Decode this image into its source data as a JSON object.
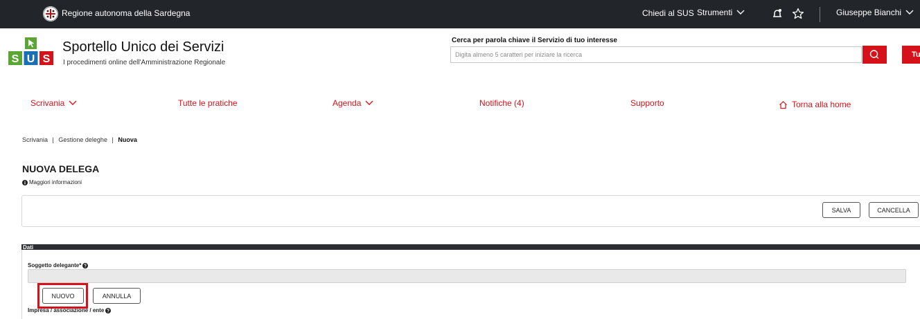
{
  "topbar": {
    "region": "Regione autonoma della Sardegna",
    "ask": "Chiedi al SUS",
    "tools": "Strumenti",
    "user": "Giuseppe Bianchi"
  },
  "header": {
    "logo_letters": [
      "S",
      "U",
      "S"
    ],
    "title": "Sportello Unico dei Servizi",
    "subtitle": "I procedimenti online dell'Amministrazione Regionale",
    "search_label": "Cerca per parola chiave il Servizio di tuo interesse",
    "search_placeholder": "Digita almeno 5 caratteri per iniziare la ricerca",
    "all_button": "Tu"
  },
  "nav": {
    "desk": "Scrivania",
    "all_cases": "Tutte le pratiche",
    "agenda": "Agenda",
    "notifications": "Notifiche (4)",
    "support": "Supporto",
    "home": "Torna alla home"
  },
  "breadcrumb": {
    "item1": "Scrivania",
    "item2": "Gestione deleghe",
    "current": "Nuova",
    "separator": "|"
  },
  "page": {
    "title": "NUOVA DELEGA",
    "more_info": "Maggiori informazioni"
  },
  "actions": {
    "save": "SALVA",
    "cancel": "CANCELLA"
  },
  "data_section": {
    "header": "Dati",
    "delegator_label": "Soggetto delegante*",
    "new_button": "NUOVO",
    "annul_button": "ANNULLA",
    "company_label": "Impresa / associazione / ente"
  },
  "colors": {
    "accent_red": "#d5111a",
    "topbar_bg": "#22262b",
    "logo_green": "#5ba534",
    "logo_blue": "#1a6fb4",
    "logo_red": "#d5111a"
  }
}
